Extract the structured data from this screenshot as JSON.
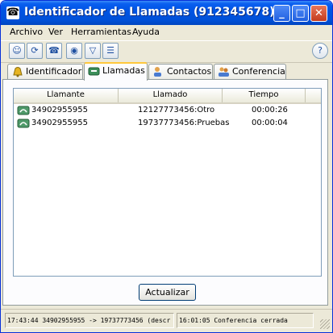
{
  "window": {
    "title": "Identificador de Llamadas (912345678)",
    "title_icon": "phone-icon"
  },
  "menu": [
    "Archivo",
    "Ver",
    "Herramientas",
    "Ayuda"
  ],
  "toolbar": {
    "buttons": [
      "user-icon",
      "refresh-icon",
      "phone-device-icon",
      "eye-icon",
      "filter-icon",
      "list-icon"
    ],
    "help": "help-icon",
    "glyphs": {
      "user": "☺",
      "refresh": "⟳",
      "phone": "☎",
      "eye": "◉",
      "filter": "▽",
      "list": "☰",
      "help": "?"
    }
  },
  "tabs": [
    "Identificador",
    "Llamadas",
    "Contactos",
    "Conferencia"
  ],
  "active_tab": "Llamadas",
  "calls": {
    "columns": [
      "Llamante",
      "Llamado",
      "Tiempo"
    ],
    "rows": [
      {
        "caller": "34902955955",
        "called": "12127773456:Otro",
        "time": "00:00:26"
      },
      {
        "caller": "34902955955",
        "called": "19737773456:Pruebas",
        "time": "00:00:04"
      }
    ]
  },
  "refresh_button": "Actualizar",
  "status": {
    "left": "17:43:44 34902955955 -> 19737773456 (descr",
    "right": "16:01:05 Conferencia cerrada"
  },
  "colors": {
    "title_bar": "#0054e3",
    "close_button": "#c43b1e",
    "active_tab_accent": "#ffc83c"
  }
}
